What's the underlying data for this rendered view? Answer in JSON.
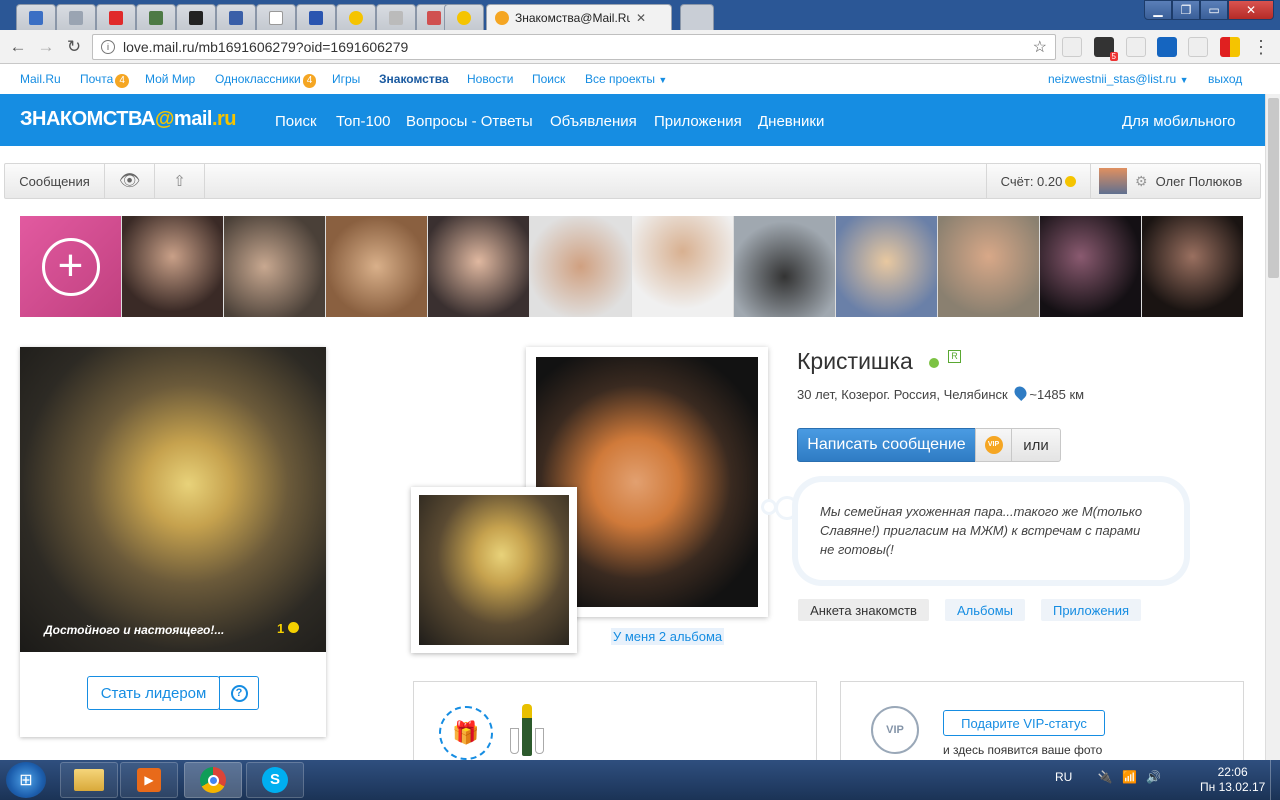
{
  "browser": {
    "active_tab_title": "Знакомства@Mail.Ru —",
    "url": "love.mail.ru/mb1691606279?oid=1691606279",
    "extension_badge": "5"
  },
  "portal": {
    "links": [
      {
        "label": "Mail.Ru"
      },
      {
        "label": "Почта",
        "badge": "4"
      },
      {
        "label": "Мой Мир"
      },
      {
        "label": "Одноклассники",
        "badge": "4"
      },
      {
        "label": "Игры"
      },
      {
        "label": "Знакомства"
      },
      {
        "label": "Новости"
      },
      {
        "label": "Поиск"
      },
      {
        "label": "Все проекты"
      }
    ],
    "user_email": "neizwestnii_stas@list.ru",
    "logout": "выход"
  },
  "header": {
    "logo_left": "ЗНАКОМСТВА",
    "logo_at": "@",
    "logo_right": "mail",
    "logo_ru": ".ru",
    "nav": [
      "Поиск",
      "Топ-100",
      "Вопросы - Ответы",
      "Объявления",
      "Приложения",
      "Дневники"
    ],
    "mobile": "Для мобильного"
  },
  "subbar": {
    "messages": "Сообщения",
    "balance": "Счёт: 0.20",
    "user_name": "Олег Полюков"
  },
  "left_card": {
    "caption": "Достойного и настоящего!...",
    "count": "1",
    "leader_button": "Стать лидером",
    "help": "?"
  },
  "photos": {
    "albums_link": "У меня 2 альбома"
  },
  "profile": {
    "name": "Кристишка",
    "verified_badge": "R",
    "info": "30 лет, Козерог. Россия, Челябинск",
    "distance": "~1485 км",
    "write_button": "Написать сообщение",
    "vip_icon": "VIP",
    "or_button": "или",
    "about": "Мы семейная ухоженная пара...такого же М(только Славяне!) пригласим на МЖМ) к встречам с парами не готовы(!",
    "tabs": [
      "Анкета знакомств",
      "Альбомы",
      "Приложения"
    ]
  },
  "vip_card": {
    "button": "Подарите VIP-статус",
    "subtitle": "и здесь появится ваше фото",
    "badge": "VIP"
  },
  "taskbar": {
    "lang": "RU",
    "time": "22:06",
    "date": "Пн 13.02.17"
  },
  "colors": {
    "brand_blue": "#168de2",
    "online_green": "#7cc243",
    "coin_yellow": "#f5d000"
  }
}
